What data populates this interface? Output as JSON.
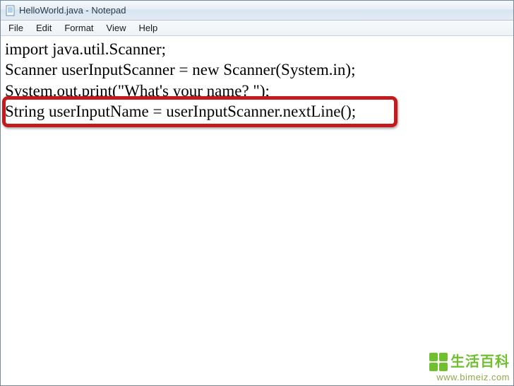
{
  "titlebar": {
    "title": "HelloWorld.java - Notepad"
  },
  "menubar": {
    "items": [
      {
        "label": "File"
      },
      {
        "label": "Edit"
      },
      {
        "label": "Format"
      },
      {
        "label": "View"
      },
      {
        "label": "Help"
      }
    ]
  },
  "content": {
    "lines": [
      "import java.util.Scanner;",
      "Scanner userInputScanner = new Scanner(System.in);",
      "System.out.print(\"What's your name? \");",
      "String userInputName = userInputScanner.nextLine();"
    ]
  },
  "watermark": {
    "text_cn": "生活百科",
    "url": "www.bimeiz.com"
  }
}
